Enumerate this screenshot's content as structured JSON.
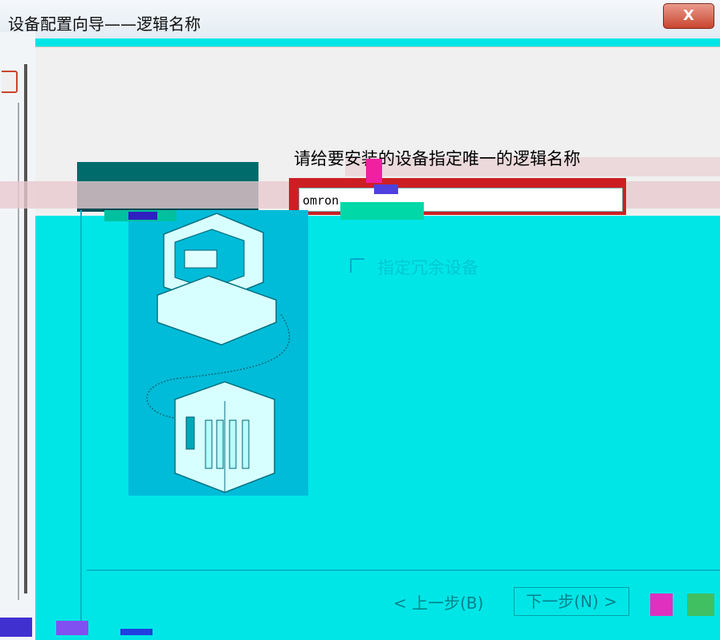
{
  "window": {
    "title": "设备配置向导——逻辑名称",
    "close_label": "X"
  },
  "main": {
    "heading": "请给要安装的设备指定唯一的逻辑名称",
    "name_input_value": "omron",
    "redundant_checkbox_label": "指定冗余设备"
  },
  "footer": {
    "back_button": "< 上一步(B)",
    "next_button": "下一步(N) >"
  },
  "colors": {
    "background": "#00e6e6",
    "illustration_bg": "#00bcd9",
    "input_highlight": "#cc1f24",
    "close_button": "#c9452e"
  }
}
